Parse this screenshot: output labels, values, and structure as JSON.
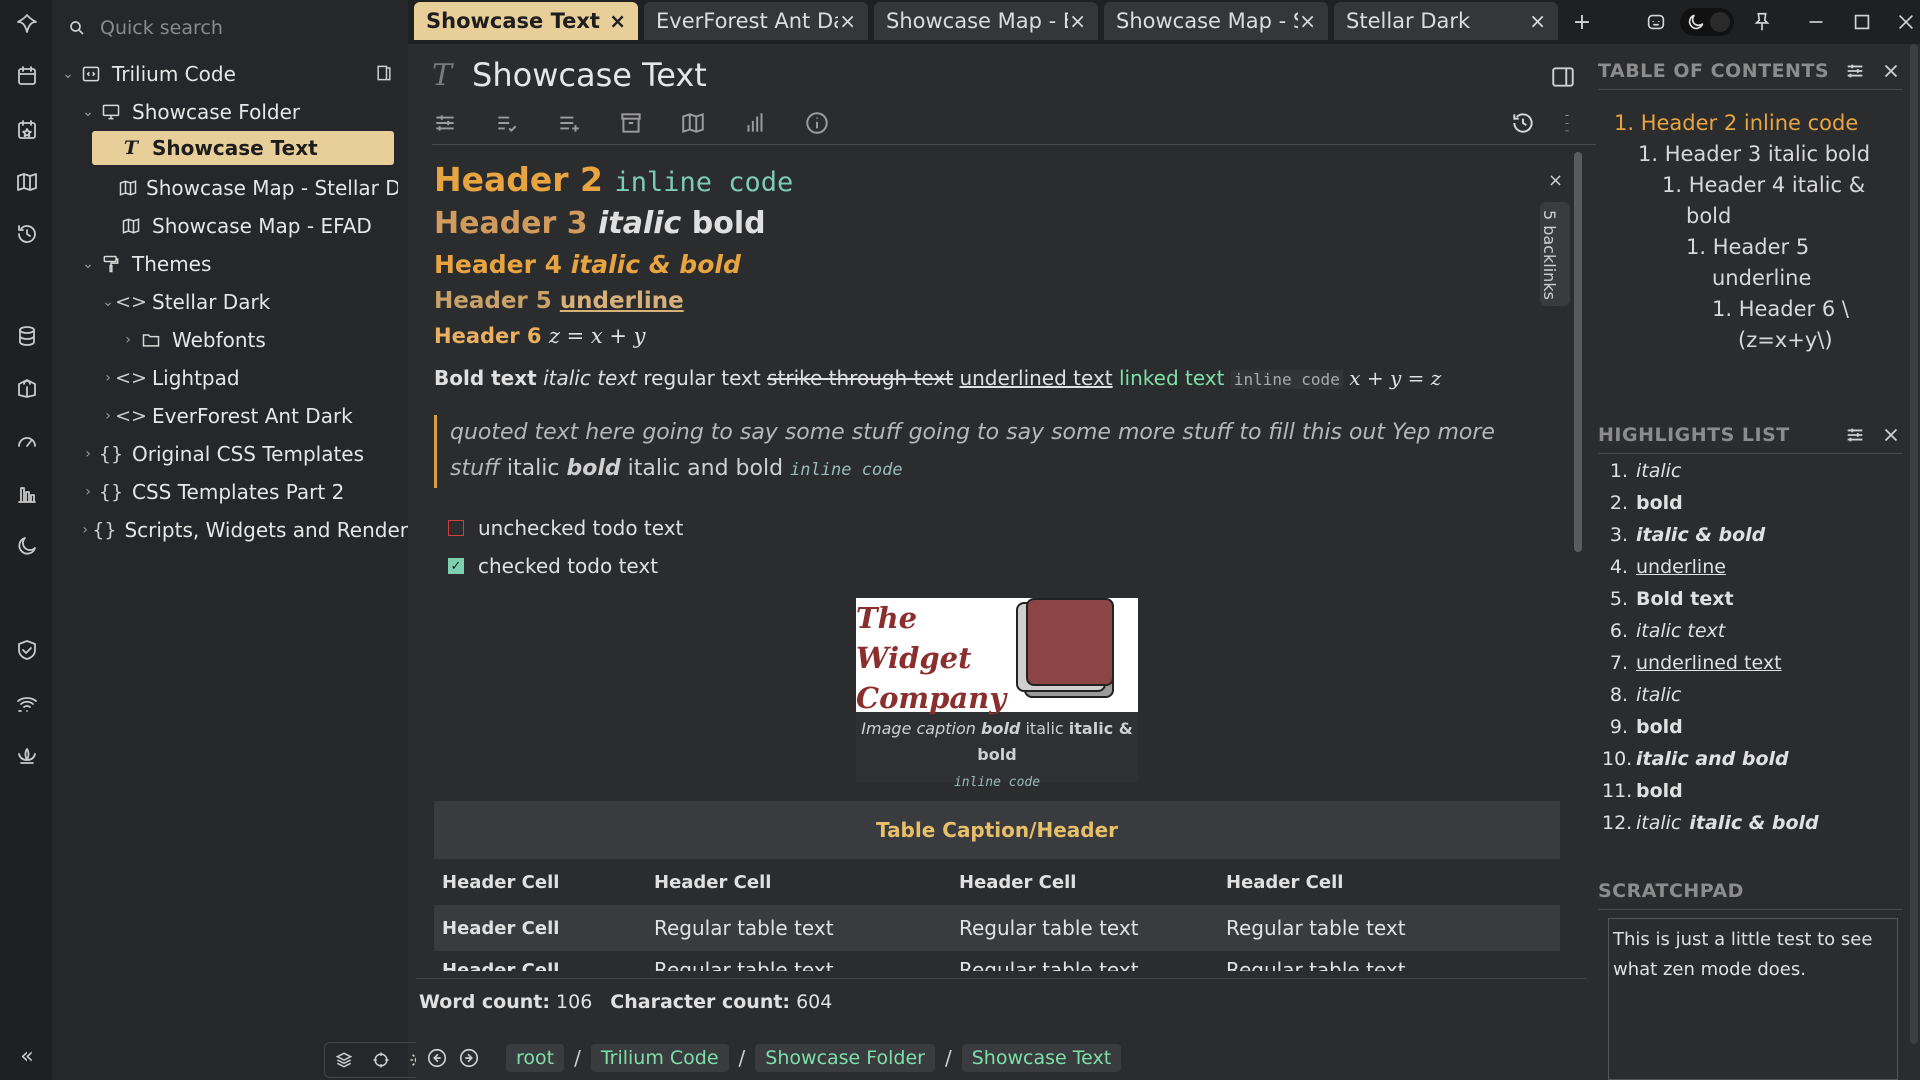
{
  "search": {
    "placeholder": "Quick search"
  },
  "tree": [
    {
      "label": "Trilium Code"
    },
    {
      "label": "Showcase Folder"
    },
    {
      "label": "Showcase Text"
    },
    {
      "label": "Showcase Map - Stellar Da"
    },
    {
      "label": "Showcase Map - EFAD"
    },
    {
      "label": "Themes"
    },
    {
      "label": "Stellar Dark"
    },
    {
      "label": "Webfonts"
    },
    {
      "label": "Lightpad"
    },
    {
      "label": "EverForest Ant Dark"
    },
    {
      "label": "Original CSS Templates"
    },
    {
      "label": "CSS Templates Part 2"
    },
    {
      "label": "Scripts, Widgets and Render"
    }
  ],
  "tabs": [
    {
      "label": "Showcase Text",
      "close": "×"
    },
    {
      "label": "EverForest Ant Da",
      "close": "×"
    },
    {
      "label": "Showcase Map - E",
      "close": "×"
    },
    {
      "label": "Showcase Map - S",
      "close": "×"
    },
    {
      "label": "Stellar Dark",
      "close": "×"
    }
  ],
  "tab_add": "+",
  "note": {
    "title": "Showcase Text",
    "h2": {
      "text": "Header 2",
      "code": "inline code"
    },
    "h3": {
      "text": "Header 3",
      "italic": "italic",
      "bold": "bold"
    },
    "h4": {
      "text": "Header 4",
      "italic": "italic & bold"
    },
    "h5": {
      "text": "Header 5",
      "underline": "underline"
    },
    "h6": {
      "text": "Header 6",
      "math": "z = x + y"
    },
    "para": {
      "bold": "Bold text",
      "italic": "italic text",
      "regular": "regular text",
      "strike": "strike through text",
      "underline": "underlined text",
      "link": "linked text",
      "code": "inline code",
      "math": "x + y = z"
    },
    "quote": {
      "text": "quoted text here going to say some stuff going to say some more stuff to fill this out Yep more stuff",
      "italic": "italic",
      "bold": "bold",
      "ib": "italic and bold",
      "code": "inline code"
    },
    "todos": [
      {
        "label": "unchecked todo text",
        "checked": false
      },
      {
        "label": "checked todo text",
        "checked": true
      }
    ],
    "figure": {
      "logo": [
        "The",
        "Widget",
        "Company"
      ],
      "caption_prefix": "Image caption",
      "caption_bold": "bold",
      "caption_italic": "italic",
      "caption_ib": "italic & bold",
      "caption_code": "inline code"
    },
    "table": {
      "caption": "Table Caption/Header",
      "headers": [
        "Header Cell",
        "Header Cell",
        "Header Cell",
        "Header Cell"
      ],
      "rows": [
        [
          "Header Cell",
          "Regular table text",
          "Regular table text",
          "Regular table text"
        ],
        [
          "Header Cell",
          "Regular table text",
          "Regular table text",
          "Regular table text"
        ]
      ]
    },
    "backlinks": "5 backlinks",
    "close": "×"
  },
  "status": {
    "word_label": "Word count:",
    "word_value": "106",
    "char_label": "Character count:",
    "char_value": "604"
  },
  "breadcrumbs": [
    "root",
    "Trilium Code",
    "Showcase Folder",
    "Showcase Text"
  ],
  "breadcrumb_sep": "/",
  "toc": {
    "title": "TABLE OF CONTENTS",
    "items": [
      "1. Header 2 inline code",
      "1. Header 3 italic bold",
      "1. Header 4 italic &",
      "bold",
      "1. Header 5",
      "underline",
      "1. Header 6 \\",
      "(z=x+y\\)"
    ]
  },
  "highlights": {
    "title": "HIGHLIGHTS LIST",
    "items": [
      {
        "n": "1.",
        "text": "italic"
      },
      {
        "n": "2.",
        "text": "bold"
      },
      {
        "n": "3.",
        "text": "italic & bold"
      },
      {
        "n": "4.",
        "text": "underline"
      },
      {
        "n": "5.",
        "text": "Bold text"
      },
      {
        "n": "6.",
        "text": "italic text"
      },
      {
        "n": "7.",
        "text": "underlined text"
      },
      {
        "n": "8.",
        "text": "italic"
      },
      {
        "n": "9.",
        "text": "bold"
      },
      {
        "n": "10.",
        "text": "italic and bold"
      },
      {
        "n": "11.",
        "text": "bold"
      },
      {
        "n": "12.",
        "text": "italic",
        "text2": "italic & bold"
      }
    ]
  },
  "scratchpad": {
    "title": "SCRATCHPAD",
    "text": "This is just a little test to see what zen mode does."
  },
  "colors": {
    "accent": "#e8cf9a",
    "heading": "#e8a440",
    "link": "#7de0a8"
  }
}
